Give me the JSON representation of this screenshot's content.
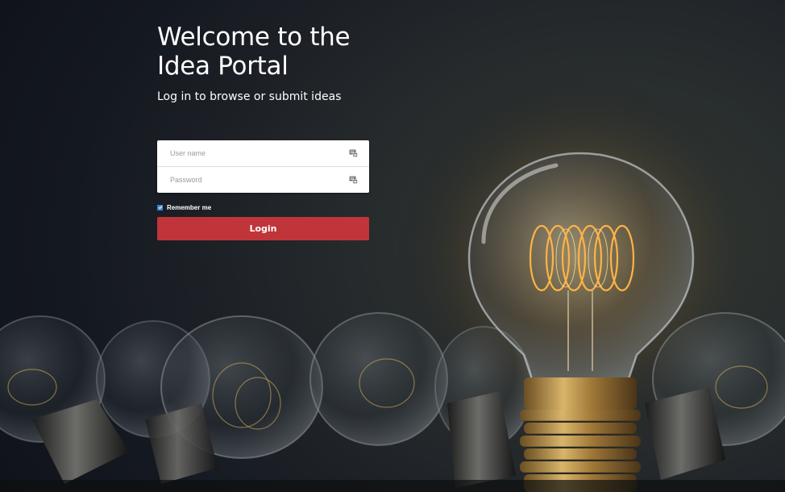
{
  "header": {
    "title": "Welcome to the Idea Portal",
    "subtitle": "Log in to browse or submit ideas"
  },
  "login_form": {
    "username": {
      "placeholder": "User name",
      "value": "",
      "icon": "credentials-icon"
    },
    "password": {
      "placeholder": "Password",
      "value": "",
      "icon": "credentials-icon"
    },
    "remember_me": {
      "label": "Remember me",
      "checked": true
    },
    "submit_label": "Login"
  },
  "colors": {
    "login_button": "#c0353a",
    "checkbox": "#3b89d6",
    "background": "#1a1e24"
  }
}
